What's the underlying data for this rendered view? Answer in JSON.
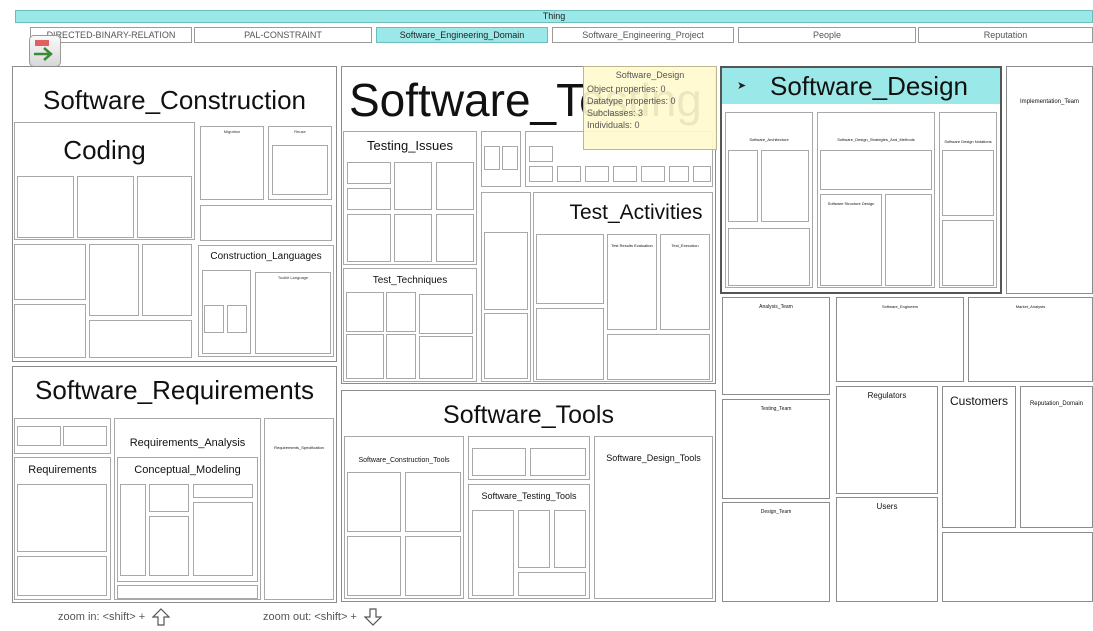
{
  "root_label": "Thing",
  "tabs": [
    {
      "label": "DIRECTED-BINARY-RELATION",
      "selected": false
    },
    {
      "label": "PAL-CONSTRAINT",
      "selected": false
    },
    {
      "label": "Software_Engineering_Domain",
      "selected": true
    },
    {
      "label": "Software_Engineering_Project",
      "selected": false
    },
    {
      "label": "People",
      "selected": false
    },
    {
      "label": "Reputation",
      "selected": false
    }
  ],
  "nav_icon": "back-arrow-icon",
  "construction": {
    "title": "Software_Construction",
    "coding": "Coding",
    "migration": "Migration",
    "reuse": "Reuse",
    "construction_languages": "Construction_Languages",
    "toolkit_language": "Toolkit Language"
  },
  "testing": {
    "title": "Software_Testing",
    "testing_issues": "Testing_Issues",
    "test_activities": "Test_Activities",
    "test_techniques": "Test_Techniques",
    "test_results_evaluation": "Test Results Evaluation",
    "test_execution": "Test_Execution"
  },
  "design": {
    "title": "Software_Design",
    "architecture": "Software_Architecture",
    "strategies": "Software_Design_Strategies_And_Methods",
    "notations": "Software Design Notations",
    "structure": "Software Structure Design"
  },
  "tooltip": {
    "title": "Software_Design",
    "object_properties": "Object properties: 0",
    "datatype_properties": "Datatype properties: 0",
    "subclasses": "Subclasses: 3",
    "individuals": "Individuals: 0"
  },
  "requirements": {
    "title": "Software_Requirements",
    "analysis": "Requirements_Analysis",
    "requirements": "Requirements",
    "conceptual_modeling": "Conceptual_Modeling",
    "specification": "Requirements_Specification"
  },
  "tools": {
    "title": "Software_Tools",
    "construction_tools": "Software_Construction_Tools",
    "design_tools": "Software_Design_Tools",
    "testing_tools": "Software_Testing_Tools"
  },
  "people": {
    "implementation_team": "Implementation_Team",
    "analysis_team": "Analysis_Team",
    "software_engineers": "Software_Engineers",
    "market_analysts": "Market_Analysts",
    "testing_team": "Testing_Team",
    "regulators": "Regulators",
    "design_team": "Design_Team",
    "users": "Users"
  },
  "reputation": {
    "customers": "Customers",
    "reputation_domain": "Reputation_Domain"
  },
  "footer": {
    "zoom_in": "zoom in: <shift> +",
    "zoom_out": "zoom out: <shift> +"
  },
  "colors": {
    "selected": "#9be8e8",
    "tooltip_bg": "#fffacd",
    "border": "#8c8c8c"
  }
}
